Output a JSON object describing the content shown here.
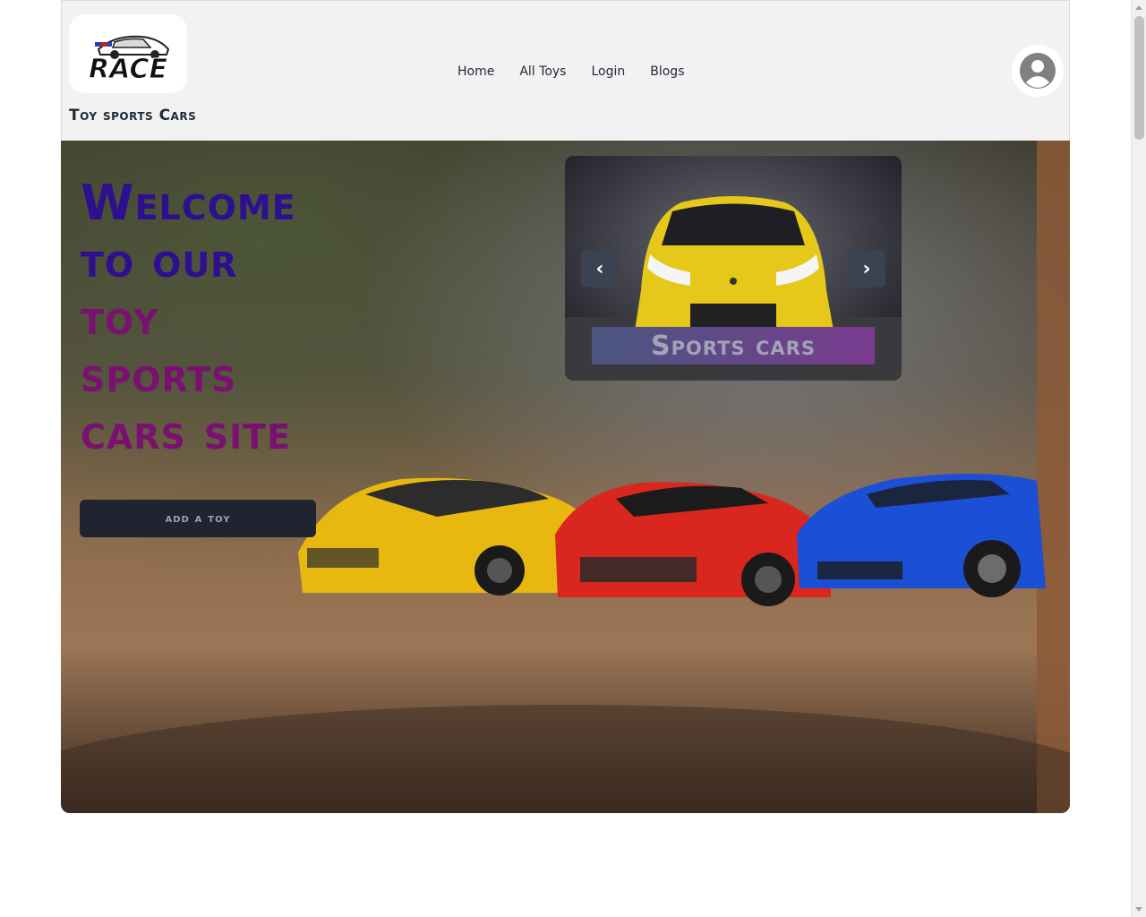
{
  "header": {
    "logo_text": "RACE",
    "site_title": "Toy sports Cars",
    "nav": [
      {
        "label": "Home"
      },
      {
        "label": "All Toys"
      },
      {
        "label": "Login"
      },
      {
        "label": "Blogs"
      }
    ],
    "avatar_icon": "user-avatar-icon"
  },
  "hero": {
    "heading_lines": [
      "Welcome",
      "to our",
      "toy",
      "sports",
      "cars site"
    ],
    "add_button_label": "add a toy",
    "carousel": {
      "caption": "Sports cars",
      "prev_symbol": "‹",
      "next_symbol": "›"
    }
  },
  "colors": {
    "heading_primary": "#2e0f8f",
    "heading_secondary": "#7a1171",
    "button_bg": "#1f2430",
    "navbar_bg": "#f2f2f2"
  }
}
